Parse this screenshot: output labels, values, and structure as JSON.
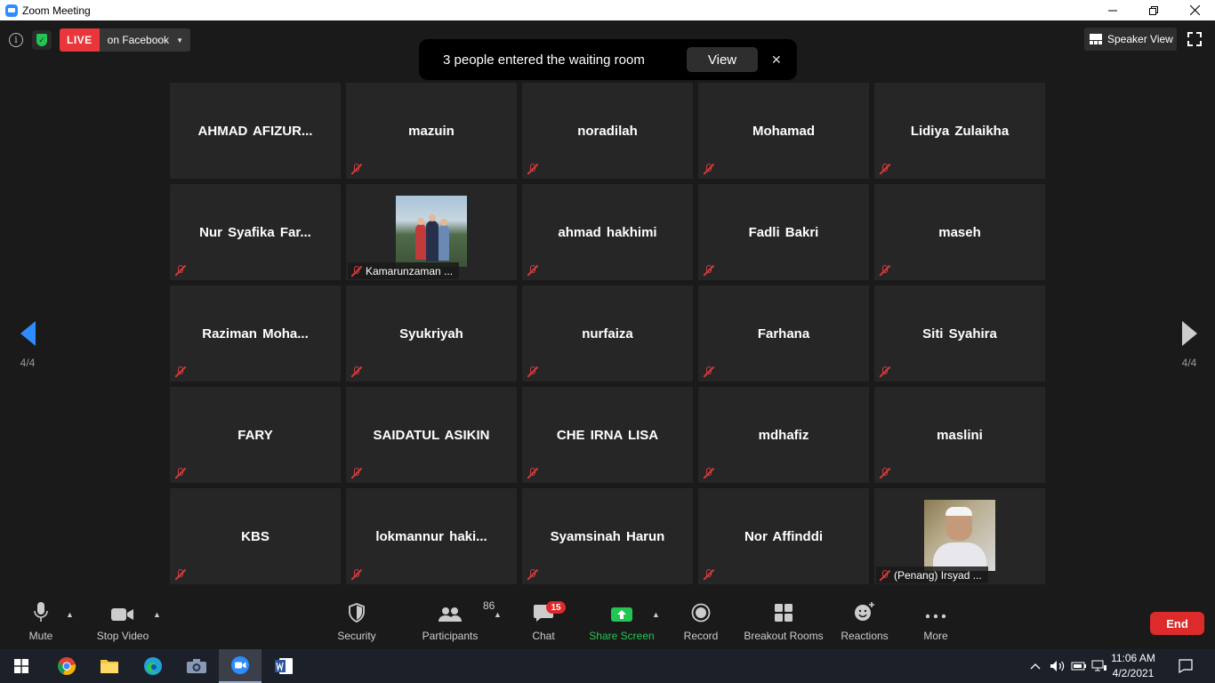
{
  "window": {
    "title": "Zoom Meeting",
    "minimize_icon": "minimize-icon",
    "restore_icon": "restore-icon",
    "close_icon": "close-icon"
  },
  "topbar": {
    "live_label": "LIVE",
    "live_destination": "on Facebook",
    "speaker_view_label": "Speaker View"
  },
  "notification": {
    "message": "3 people entered the waiting room",
    "view_label": "View",
    "close_glyph": "✕"
  },
  "paging": {
    "left_page": "4/4",
    "right_page": "4/4"
  },
  "participants": [
    {
      "name": "AHMAD  AFIZUR..."
    },
    {
      "name": "mazuin"
    },
    {
      "name": "noradilah"
    },
    {
      "name": "Mohamad"
    },
    {
      "name": "Lidiya Zulaikha"
    },
    {
      "name": "Nur  Syafika  Far..."
    },
    {
      "name": "Kamarunzaman ..."
    },
    {
      "name": "ahmad hakhimi"
    },
    {
      "name": "Fadli Bakri"
    },
    {
      "name": "maseh"
    },
    {
      "name": "Raziman  Moha..."
    },
    {
      "name": "Syukriyah"
    },
    {
      "name": "nurfaiza"
    },
    {
      "name": "Farhana"
    },
    {
      "name": "Siti Syahira"
    },
    {
      "name": "FARY"
    },
    {
      "name": "SAIDATUL ASIKIN"
    },
    {
      "name": "CHE IRNA LISA"
    },
    {
      "name": "mdhafiz"
    },
    {
      "name": "maslini"
    },
    {
      "name": "KBS"
    },
    {
      "name": "lokmannur  haki..."
    },
    {
      "name": "Syamsinah Harun"
    },
    {
      "name": "Nor Affinddi"
    },
    {
      "name": "(Penang) Irsyad ..."
    }
  ],
  "toolbar": {
    "mute_label": "Mute",
    "stop_video_label": "Stop Video",
    "security_label": "Security",
    "participants_label": "Participants",
    "participants_count": "86",
    "chat_label": "Chat",
    "chat_badge": "15",
    "share_screen_label": "Share Screen",
    "record_label": "Record",
    "breakout_rooms_label": "Breakout Rooms",
    "reactions_label": "Reactions",
    "more_label": "More",
    "end_label": "End"
  },
  "taskbar": {
    "time": "11:06 AM",
    "date": "4/2/2021"
  },
  "colors": {
    "accent_blue": "#2d8cff",
    "live_red": "#e8363b",
    "share_green": "#23c552",
    "end_red": "#dd2b2b",
    "mic_muted_red": "#d63b3b"
  }
}
